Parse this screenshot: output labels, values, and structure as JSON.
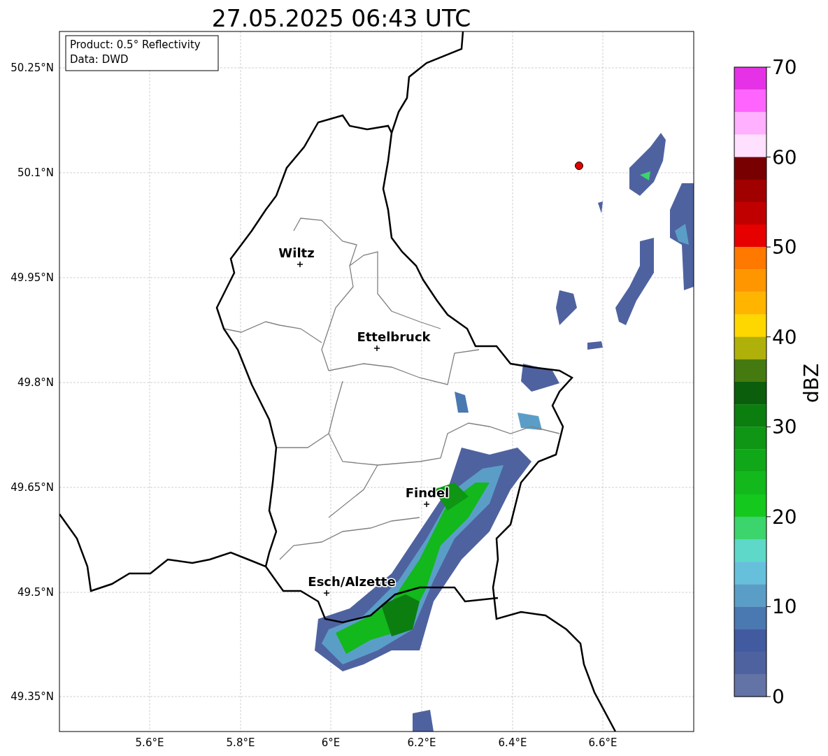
{
  "title": "27.05.2025 06:43 UTC",
  "info_box": [
    "Product: 0.5° Reflectivity",
    "Data: DWD"
  ],
  "lat_ticks": [
    "50.25°N",
    "50.1°N",
    "49.95°N",
    "49.8°N",
    "49.65°N",
    "49.5°N",
    "49.35°N"
  ],
  "lon_ticks": [
    "5.6°E",
    "5.8°E",
    "6°E",
    "6.2°E",
    "6.4°E",
    "6.6°E"
  ],
  "cities": [
    {
      "name": "Wiltz"
    },
    {
      "name": "Ettelbruck"
    },
    {
      "name": "Findel"
    },
    {
      "name": "Esch/Alzette"
    }
  ],
  "colorbar": {
    "label": "dBZ",
    "ticks": [
      "70",
      "60",
      "50",
      "40",
      "30",
      "20",
      "10",
      "0"
    ],
    "segments": [
      {
        "color": "#e632e6"
      },
      {
        "color": "#ff64ff"
      },
      {
        "color": "#ffb0ff"
      },
      {
        "color": "#ffe0ff"
      },
      {
        "color": "#780000"
      },
      {
        "color": "#a00000"
      },
      {
        "color": "#c00000"
      },
      {
        "color": "#e60000"
      },
      {
        "color": "#ff7800"
      },
      {
        "color": "#ff9600"
      },
      {
        "color": "#ffb400"
      },
      {
        "color": "#ffd700"
      },
      {
        "color": "#b0b00a"
      },
      {
        "color": "#457a10"
      },
      {
        "color": "#0a5e0c"
      },
      {
        "color": "#0c7e10"
      },
      {
        "color": "#0e9614"
      },
      {
        "color": "#10a818"
      },
      {
        "color": "#12b81c"
      },
      {
        "color": "#14c81e"
      },
      {
        "color": "#3cd46c"
      },
      {
        "color": "#5ed8c8"
      },
      {
        "color": "#66c0dc"
      },
      {
        "color": "#5a9ec8"
      },
      {
        "color": "#4a78b0"
      },
      {
        "color": "#415aa0"
      },
      {
        "color": "#4f62a0"
      },
      {
        "color": "#6473a6"
      }
    ]
  }
}
